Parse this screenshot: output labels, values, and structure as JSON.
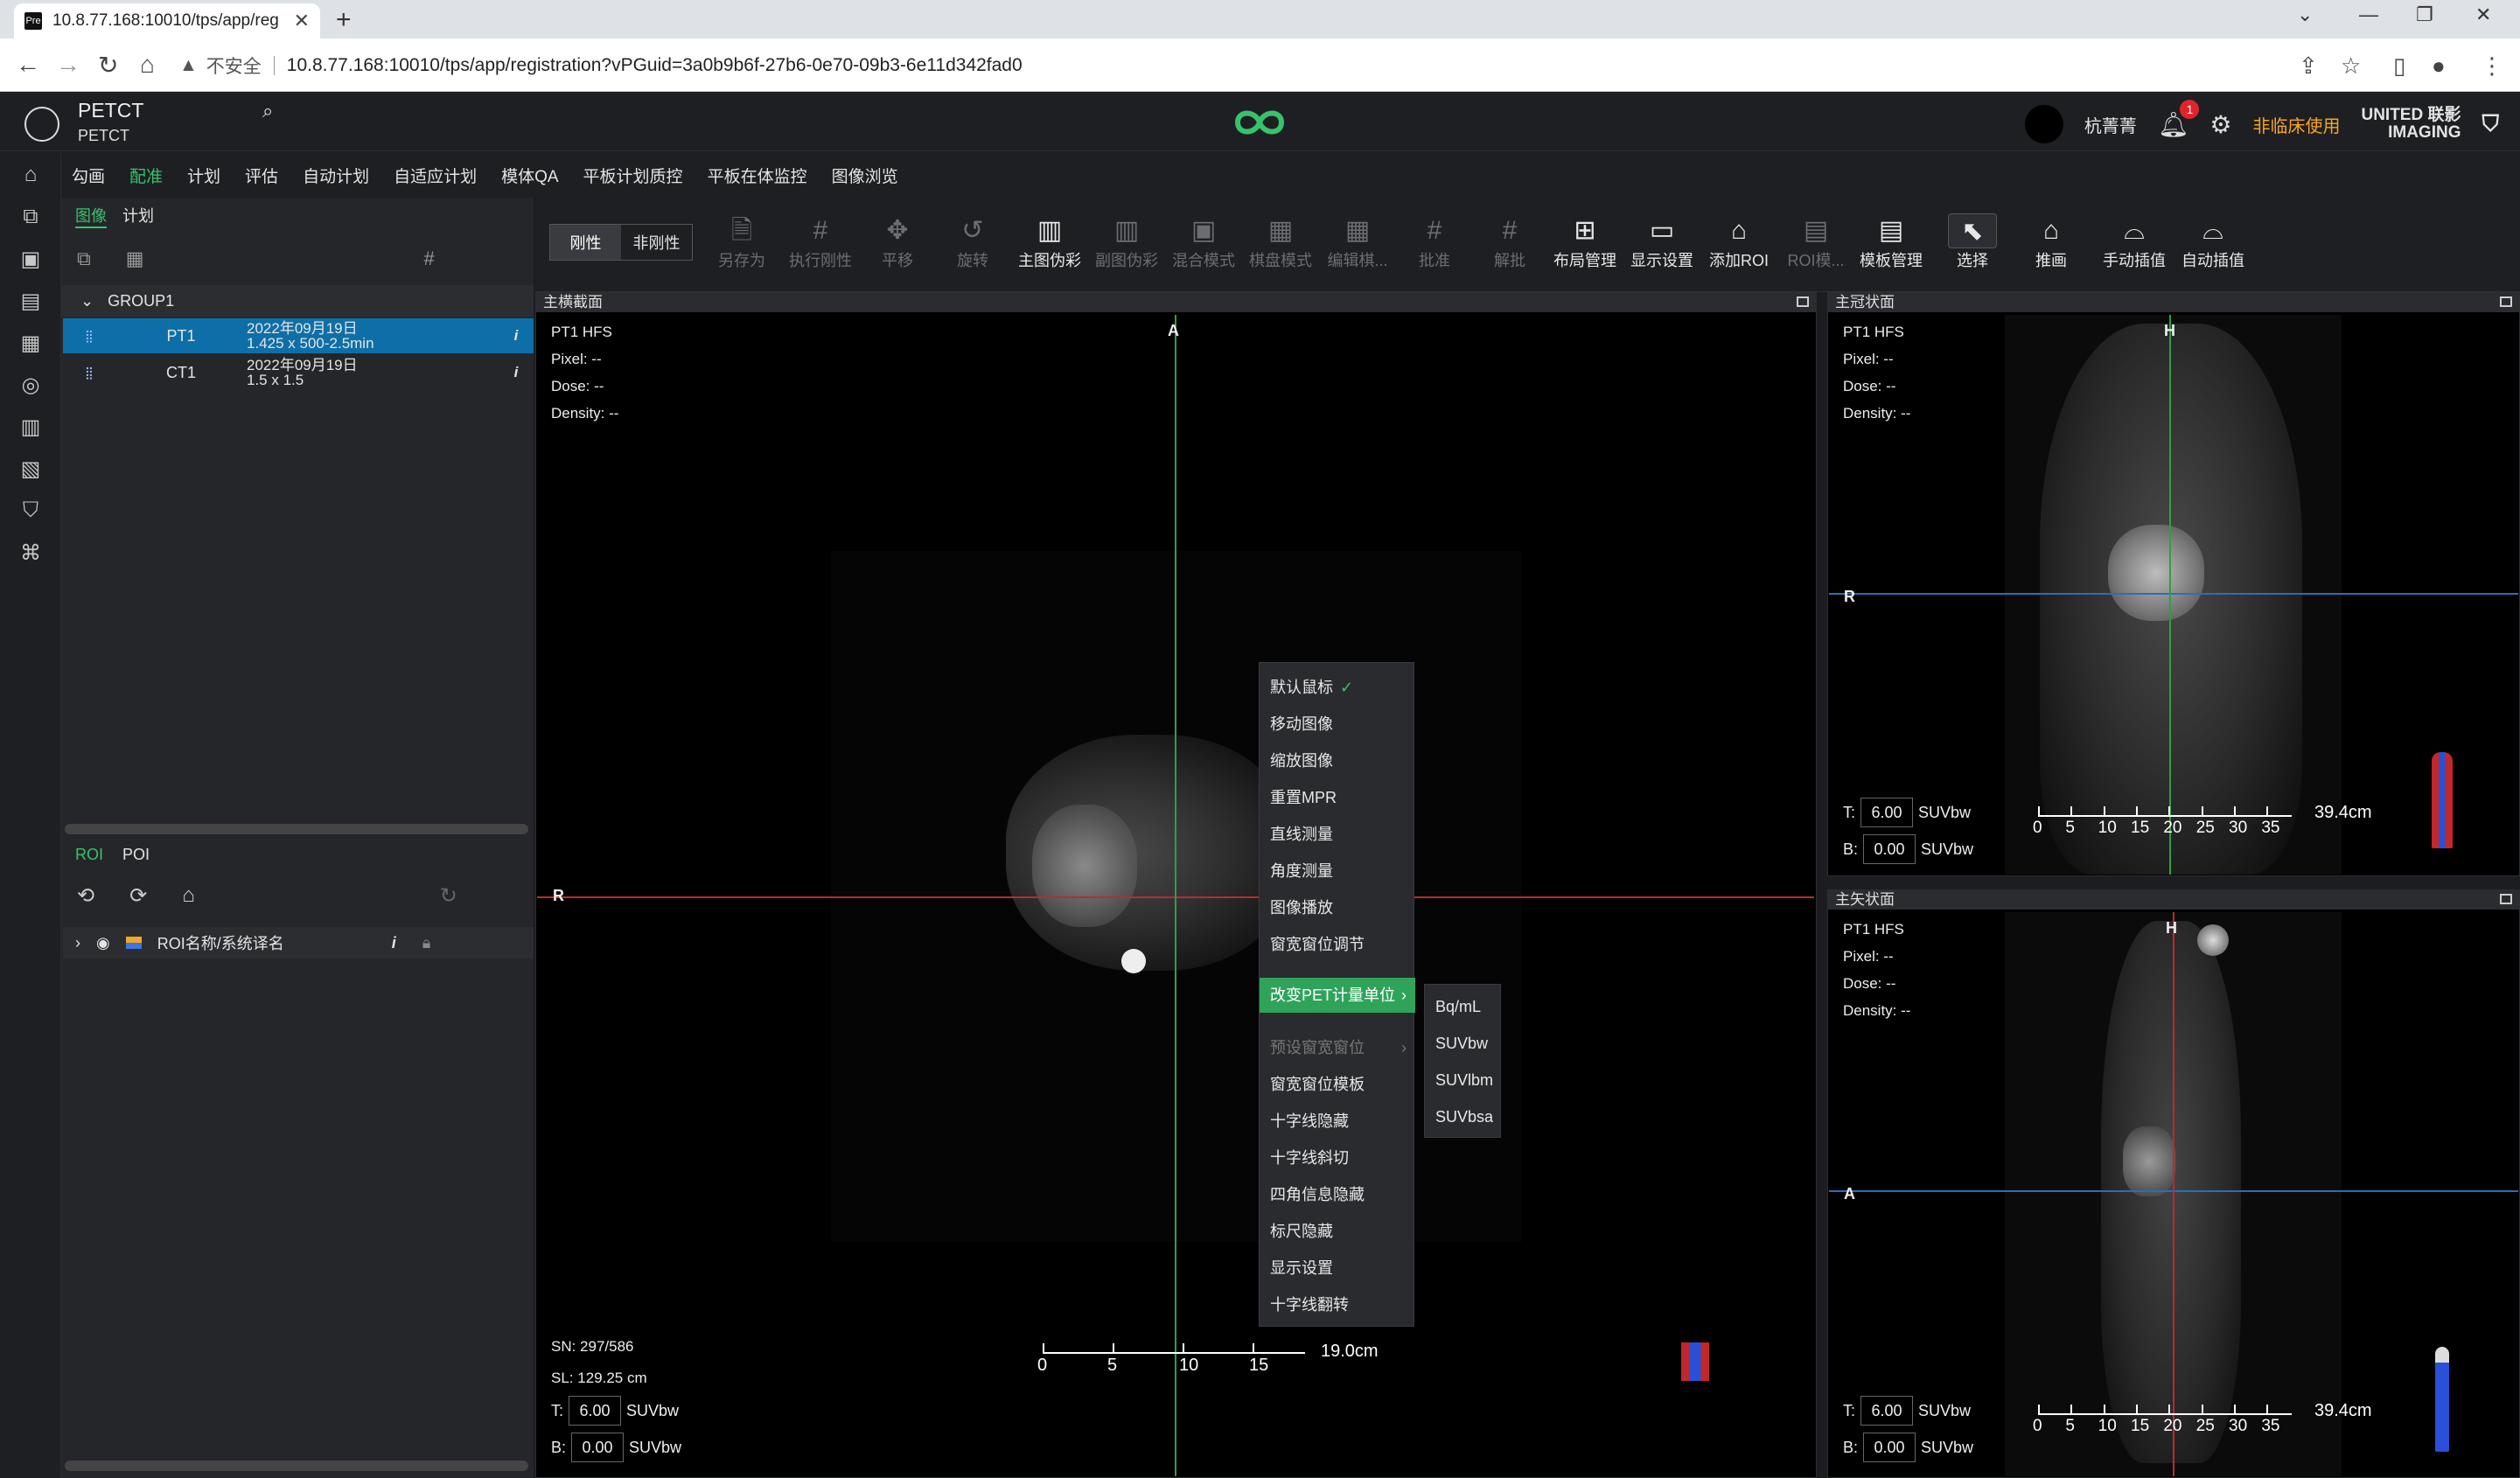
{
  "browser": {
    "tab_title": "10.8.77.168:10010/tps/app/reg",
    "favicon_text": "Pre",
    "insecure_label": "不安全",
    "url": "10.8.77.168:10010/tps/app/registration?vPGuid=3a0b9b6f-27b6-0e70-09b3-6e11d342fad0"
  },
  "header": {
    "project_title": "PETCT",
    "project_sub": "PETCT",
    "user_name": "杭菁菁",
    "notifications": "1",
    "clinical_notice": "非临床使用",
    "brand_line1": "UNITED 联影",
    "brand_line2": "IMAGING"
  },
  "menu": [
    "勾画",
    "配准",
    "计划",
    "评估",
    "自动计划",
    "自适应计划",
    "模体QA",
    "平板计划质控",
    "平板在体监控",
    "图像浏览"
  ],
  "menu_active_index": 1,
  "left_panel": {
    "tabs": [
      "图像",
      "计划"
    ],
    "group_name": "GROUP1",
    "series": [
      {
        "name": "PT1",
        "date": "2022年09月19日",
        "size": "1.425 x 500-2.5min",
        "info": "i"
      },
      {
        "name": "CT1",
        "date": "2022年09月19日",
        "size": "1.5 x 1.5",
        "info": "i"
      }
    ],
    "roi_tabs": [
      "ROI",
      "POI"
    ],
    "roi_row_label": "ROI名称/系统译名",
    "roi_info": "i"
  },
  "toolbar": {
    "mode_buttons": [
      "刚性",
      "非刚性"
    ],
    "tools": [
      {
        "label": "另存为",
        "icon": "save-as-icon"
      },
      {
        "label": "执行刚性",
        "icon": "run-rigid-icon"
      },
      {
        "label": "平移",
        "icon": "move-icon"
      },
      {
        "label": "旋转",
        "icon": "rotate-icon"
      },
      {
        "label": "主图伪彩",
        "icon": "primary-color-icon"
      },
      {
        "label": "副图伪彩",
        "icon": "secondary-color-icon"
      },
      {
        "label": "混合模式",
        "icon": "blend-icon"
      },
      {
        "label": "棋盘模式",
        "icon": "checkerboard-icon"
      },
      {
        "label": "编辑棋...",
        "icon": "edit-checker-icon"
      },
      {
        "label": "批准",
        "icon": "approve-icon"
      },
      {
        "label": "解批",
        "icon": "unapprove-icon"
      },
      {
        "label": "布局管理",
        "icon": "layout-icon"
      },
      {
        "label": "显示设置",
        "icon": "display-settings-icon"
      },
      {
        "label": "添加ROI",
        "icon": "add-roi-icon"
      },
      {
        "label": "ROI模...",
        "icon": "roi-template-icon"
      },
      {
        "label": "模板管理",
        "icon": "template-manage-icon"
      },
      {
        "label": "选择",
        "icon": "select-icon"
      },
      {
        "label": "推画",
        "icon": "push-draw-icon"
      },
      {
        "label": "手动插值",
        "icon": "manual-interp-icon"
      },
      {
        "label": "自动插值",
        "icon": "auto-interp-icon"
      }
    ]
  },
  "viewports": {
    "axial": {
      "title": "主横截面",
      "series": "PT1 HFS",
      "pixel": "Pixel:  --",
      "dose": "Dose:  --",
      "density": "Density:  --",
      "label_top": "A",
      "label_left": "R",
      "sn": "SN: 297/586",
      "sl": "SL: 129.25 cm",
      "t_label": "T:",
      "t_value": "6.00",
      "b_label": "B:",
      "b_value": "0.00",
      "unit": "SUVbw",
      "scale_ticks": [
        "0",
        "5",
        "10",
        "15"
      ],
      "scale_length": "19.0cm"
    },
    "coronal": {
      "title": "主冠状面",
      "series": "PT1 HFS",
      "pixel": "Pixel:  --",
      "dose": "Dose:  --",
      "density": "Density:  --",
      "label_top": "H",
      "label_left": "R",
      "t_label": "T:",
      "t_value": "6.00",
      "b_label": "B:",
      "b_value": "0.00",
      "unit": "SUVbw",
      "scale_ticks": [
        "0",
        "5",
        "10",
        "15",
        "20",
        "25",
        "30",
        "35"
      ],
      "scale_length": "39.4cm"
    },
    "sagittal": {
      "title": "主矢状面",
      "series": "PT1 HFS",
      "pixel": "Pixel:  --",
      "dose": "Dose:  --",
      "density": "Density:  --",
      "label_top": "H",
      "label_left": "A",
      "t_label": "T:",
      "t_value": "6.00",
      "b_label": "B:",
      "b_value": "0.00",
      "unit": "SUVbw",
      "scale_ticks": [
        "0",
        "5",
        "10",
        "15",
        "20",
        "25",
        "30",
        "35"
      ],
      "scale_length": "39.4cm"
    }
  },
  "context_menu": {
    "items": [
      "默认鼠标",
      "移动图像",
      "缩放图像",
      "重置MPR",
      "直线测量",
      "角度测量",
      "图像播放",
      "窗宽窗位调节",
      "改变PET计量单位",
      "预设窗宽窗位",
      "窗宽窗位模板",
      "十字线隐藏",
      "十字线斜切",
      "四角信息隐藏",
      "标尺隐藏",
      "显示设置",
      "十字线翻转"
    ],
    "checked_index": 0,
    "highlight_index": 8,
    "disabled_index": 9,
    "check_mark": "✓",
    "submenu": [
      "Bq/mL",
      "SUVbw",
      "SUVlbm",
      "SUVbsa"
    ]
  },
  "colors": {
    "accent": "#37c36b",
    "crosshair_red": "#c0282b",
    "crosshair_green": "#2ea043",
    "crosshair_blue": "#2a6fb5",
    "menu_highlight": "#2fa35a"
  }
}
